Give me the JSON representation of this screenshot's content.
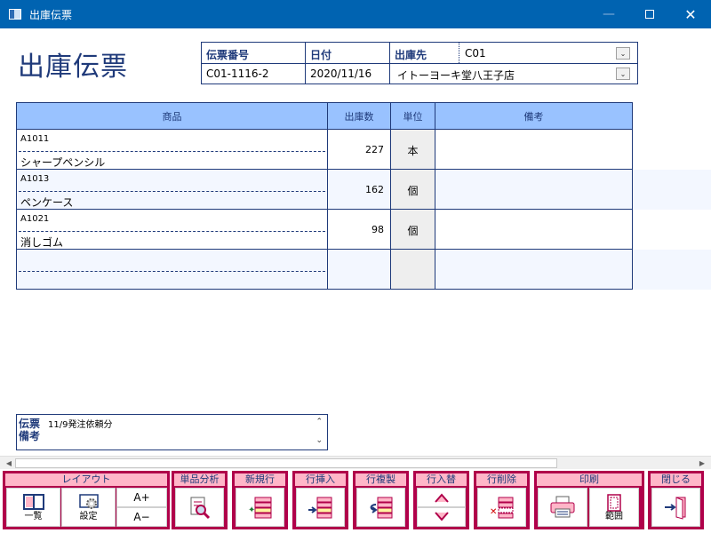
{
  "window": {
    "title": "出庫伝票"
  },
  "page_title": "出庫伝票",
  "header": {
    "slip_no_label": "伝票番号",
    "slip_no": "C01-1116-2",
    "date_label": "日付",
    "date": "2020/11/16",
    "dest_label": "出庫先",
    "dest_code": "C01",
    "dest_name": "イトーヨーキ堂八王子店"
  },
  "grid": {
    "columns": [
      "商品",
      "出庫数",
      "単位",
      "備考"
    ],
    "rows": [
      {
        "code": "A1011",
        "name": "シャープペンシル",
        "qty": "227",
        "unit": "本",
        "note": ""
      },
      {
        "code": "A1013",
        "name": "ペンケース",
        "qty": "162",
        "unit": "個",
        "note": ""
      },
      {
        "code": "A1021",
        "name": "消しゴム",
        "qty": "98",
        "unit": "個",
        "note": ""
      },
      {
        "code": "",
        "name": "",
        "qty": "",
        "unit": "",
        "note": ""
      }
    ]
  },
  "remarks": {
    "label_line1": "伝票",
    "label_line2": "備考",
    "value": "11/9発注依頼分"
  },
  "toolbar": {
    "layout": {
      "label": "レイアウト",
      "list": "一覧",
      "settings": "設定",
      "font_up": "A+",
      "font_down": "A−"
    },
    "analysis": {
      "label": "単品分析"
    },
    "new_row": {
      "label": "新規行"
    },
    "insert_row": {
      "label": "行挿入"
    },
    "copy_row": {
      "label": "行複製"
    },
    "swap_row": {
      "label": "行入替"
    },
    "delete_row": {
      "label": "行削除"
    },
    "print": {
      "label": "印刷",
      "range": "範囲"
    },
    "close": {
      "label": "閉じる"
    }
  },
  "colors": {
    "titlebar": "#0063b1",
    "header_blue": "#99c2ff",
    "border_navy": "#1f3a7a",
    "toolbar_maroon": "#b0004a",
    "toolbar_label_pink": "#ffb6c8",
    "row_alt": "#f3f7ff",
    "unit_cell": "#eeeeee"
  },
  "icons": [
    "app-icon",
    "minimize-icon",
    "maximize-icon",
    "close-icon",
    "chevron-down-icon",
    "scroll-up-icon",
    "scroll-down-icon",
    "scroll-left-icon",
    "scroll-right-icon",
    "list-layout-icon",
    "gear-icon",
    "magnifier-icon",
    "new-row-icon",
    "insert-row-icon",
    "copy-row-icon",
    "arrow-up-icon",
    "arrow-down-icon",
    "delete-row-icon",
    "printer-icon",
    "print-range-icon",
    "exit-door-icon"
  ]
}
